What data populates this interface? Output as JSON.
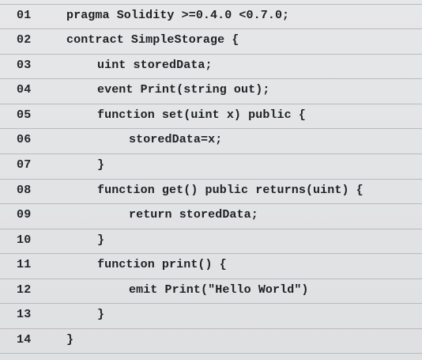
{
  "code_listing": {
    "lines": [
      {
        "number": "01",
        "code": "pragma Solidity >=0.4.0 <0.7.0;"
      },
      {
        "number": "02",
        "code": "contract SimpleStorage {"
      },
      {
        "number": "03",
        "code": "uint storedData;"
      },
      {
        "number": "04",
        "code": "event Print(string out);"
      },
      {
        "number": "05",
        "code": "function set(uint x) public {"
      },
      {
        "number": "06",
        "code": "storedData=x;"
      },
      {
        "number": "07",
        "code": "}"
      },
      {
        "number": "08",
        "code": "function get() public returns(uint) {"
      },
      {
        "number": "09",
        "code": "return storedData;"
      },
      {
        "number": "10",
        "code": "}"
      },
      {
        "number": "11",
        "code": "function print() {"
      },
      {
        "number": "12",
        "code": "emit Print(\"Hello World\")"
      },
      {
        "number": "13",
        "code": "}"
      },
      {
        "number": "14",
        "code": "}"
      }
    ]
  }
}
